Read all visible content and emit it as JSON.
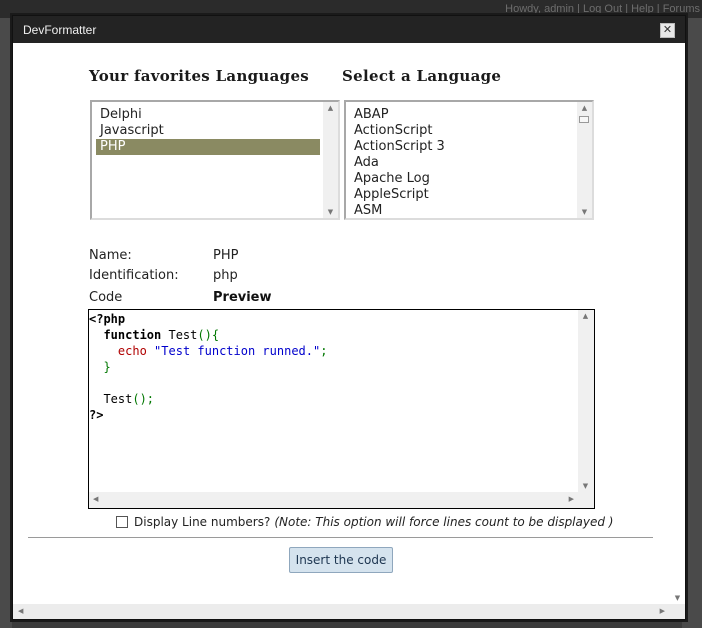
{
  "background": {
    "topbar_text": "Howdy, admin | Log Out | Help | Forums"
  },
  "dialog": {
    "title": "DevFormatter",
    "close_label": "✕"
  },
  "favorites": {
    "heading": "Your favorites Languages",
    "items": [
      "Delphi",
      "Javascript",
      "PHP"
    ],
    "selected": "PHP"
  },
  "languages": {
    "heading": "Select a Language",
    "items": [
      "ABAP",
      "ActionScript",
      "ActionScript 3",
      "Ada",
      "Apache Log",
      "AppleScript",
      "ASM"
    ]
  },
  "details": {
    "name_label": "Name:",
    "name_value": "PHP",
    "identification_label": "Identification:",
    "identification_value": "php",
    "code_label": "Code",
    "preview_label": "Preview"
  },
  "code": {
    "lines": [
      [
        {
          "t": "<?php",
          "c": "kw"
        }
      ],
      [
        {
          "t": "  ",
          "c": "plain"
        },
        {
          "t": "function",
          "c": "kw"
        },
        {
          "t": " Test",
          "c": "plain"
        },
        {
          "t": "(){",
          "c": "pun"
        }
      ],
      [
        {
          "t": "    ",
          "c": "plain"
        },
        {
          "t": "echo",
          "c": "echo"
        },
        {
          "t": " ",
          "c": "plain"
        },
        {
          "t": "\"Test function runned.\"",
          "c": "str"
        },
        {
          "t": ";",
          "c": "pun"
        }
      ],
      [
        {
          "t": "  ",
          "c": "plain"
        },
        {
          "t": "}",
          "c": "pun"
        }
      ],
      [
        {
          "t": "",
          "c": "plain"
        }
      ],
      [
        {
          "t": "  ",
          "c": "plain"
        },
        {
          "t": "Test",
          "c": "plain"
        },
        {
          "t": "();",
          "c": "pun"
        }
      ],
      [
        {
          "t": "?>",
          "c": "kw"
        }
      ]
    ]
  },
  "options": {
    "line_numbers_label": "Display Line numbers?",
    "line_numbers_note": "(Note: This option will force lines count to be displayed )",
    "line_numbers_checked": false
  },
  "actions": {
    "insert_label": "Insert the code"
  },
  "colors": {
    "selected_item_bg": "#8a8a62",
    "button_bg": "#d5e3ee",
    "titlebar_bg": "#232323"
  }
}
